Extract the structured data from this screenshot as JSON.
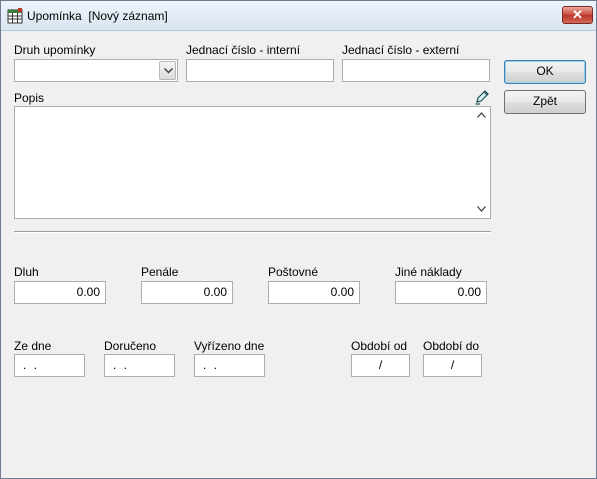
{
  "window": {
    "title": "Upomínka  [Nový záznam]",
    "close_label": "✕"
  },
  "form": {
    "druh_label": "Druh upomínky",
    "druh_value": "",
    "jednaci_interni_label": "Jednací číslo - interní",
    "jednaci_interni_value": "",
    "jednaci_externi_label": "Jednací číslo - externí",
    "jednaci_externi_value": "",
    "popis_label": "Popis",
    "popis_value": "",
    "dluh_label": "Dluh",
    "dluh_value": "0.00",
    "penale_label": "Penále",
    "penale_value": "0.00",
    "postovne_label": "Poštovné",
    "postovne_value": "0.00",
    "jine_label": "Jiné náklady",
    "jine_value": "0.00",
    "ze_dne_label": "Ze dne",
    "ze_dne_value": ". .",
    "doruceno_label": "Doručeno",
    "doruceno_value": ". .",
    "vyrizeno_label": "Vyřízeno dne",
    "vyrizeno_value": ". .",
    "obdobi_od_label": "Období od",
    "obdobi_od_value": "/",
    "obdobi_do_label": "Období do",
    "obdobi_do_value": "/"
  },
  "buttons": {
    "ok_label": "OK",
    "zpet_label": "Zpět"
  },
  "icons": {
    "app": "app-table-icon",
    "edit": "pencil-edit-icon"
  }
}
